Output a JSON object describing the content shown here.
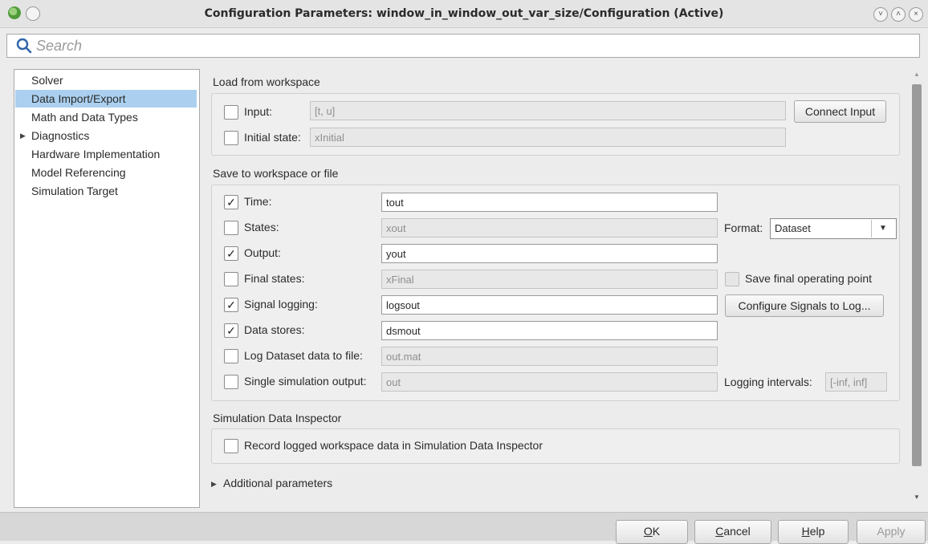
{
  "window": {
    "title": "Configuration Parameters: window_in_window_out_var_size/Configuration (Active)",
    "icons": [
      "app-icon",
      "minimize-icon",
      "maximize-icon",
      "close-icon"
    ]
  },
  "search": {
    "placeholder": "Search",
    "value": ""
  },
  "tree": {
    "items": [
      {
        "label": "Solver",
        "selected": false,
        "expandable": false
      },
      {
        "label": "Data Import/Export",
        "selected": true,
        "expandable": false
      },
      {
        "label": "Math and Data Types",
        "selected": false,
        "expandable": false
      },
      {
        "label": "Diagnostics",
        "selected": false,
        "expandable": true
      },
      {
        "label": "Hardware Implementation",
        "selected": false,
        "expandable": false
      },
      {
        "label": "Model Referencing",
        "selected": false,
        "expandable": false
      },
      {
        "label": "Simulation Target",
        "selected": false,
        "expandable": false
      }
    ]
  },
  "load": {
    "title": "Load from workspace",
    "input": {
      "label": "Input:",
      "value": "[t, u]",
      "checked": false
    },
    "initial_state": {
      "label": "Initial state:",
      "value": "xInitial",
      "checked": false
    },
    "connect_button": "Connect Input"
  },
  "save": {
    "title": "Save to workspace or file",
    "rows": [
      {
        "label": "Time:",
        "value": "tout",
        "checked": true,
        "enabled": true
      },
      {
        "label": "States:",
        "value": "xout",
        "checked": false,
        "enabled": false
      },
      {
        "label": "Output:",
        "value": "yout",
        "checked": true,
        "enabled": true
      },
      {
        "label": "Final states:",
        "value": "xFinal",
        "checked": false,
        "enabled": false
      },
      {
        "label": "Signal logging:",
        "value": "logsout",
        "checked": true,
        "enabled": true
      },
      {
        "label": "Data stores:",
        "value": "dsmout",
        "checked": true,
        "enabled": true
      },
      {
        "label": "Log Dataset data to file:",
        "value": "out.mat",
        "checked": false,
        "enabled": false
      },
      {
        "label": "Single simulation output:",
        "value": "out",
        "checked": false,
        "enabled": false
      }
    ],
    "format_label": "Format:",
    "format_value": "Dataset",
    "save_final_op_label": "Save final operating point",
    "configure_signals_button": "Configure Signals to Log...",
    "logging_intervals_label": "Logging intervals:",
    "logging_intervals_value": "[-inf, inf]"
  },
  "sdi": {
    "title": "Simulation Data Inspector",
    "record_label": "Record logged workspace data in Simulation Data Inspector",
    "checked": false
  },
  "additional": {
    "label": "Additional parameters"
  },
  "buttons": {
    "ok": {
      "hot": "O",
      "rest": "K"
    },
    "cancel": {
      "hot": "C",
      "rest": "ancel"
    },
    "help": {
      "hot": "H",
      "rest": "elp"
    },
    "apply": {
      "label": "Apply"
    }
  },
  "colors": {
    "selection": "#abd0ef",
    "scroll_thumb": "#9a9a9a"
  }
}
